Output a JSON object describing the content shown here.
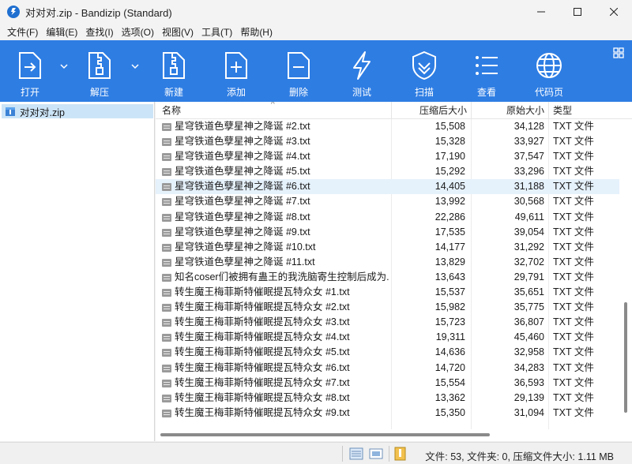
{
  "window": {
    "title": "对对对.zip - Bandizip (Standard)"
  },
  "menu": [
    "文件(F)",
    "编辑(E)",
    "查找(I)",
    "选项(O)",
    "视图(V)",
    "工具(T)",
    "帮助(H)"
  ],
  "toolbar": {
    "open": "打开",
    "extract": "解压",
    "new": "新建",
    "add": "添加",
    "delete": "删除",
    "test": "测试",
    "scan": "扫描",
    "view": "查看",
    "codepage": "代码页"
  },
  "sidebar": {
    "archive_name": "对对对.zip"
  },
  "columns": {
    "name": "名称",
    "compressed": "压缩后大小",
    "original": "原始大小",
    "type": "类型"
  },
  "files": [
    {
      "name": "星穹铁道色孽星神之降诞 #2.txt",
      "compressed": "15,508",
      "original": "34,128",
      "type": "TXT 文件"
    },
    {
      "name": "星穹铁道色孽星神之降诞 #3.txt",
      "compressed": "15,328",
      "original": "33,927",
      "type": "TXT 文件"
    },
    {
      "name": "星穹铁道色孽星神之降诞 #4.txt",
      "compressed": "17,190",
      "original": "37,547",
      "type": "TXT 文件"
    },
    {
      "name": "星穹铁道色孽星神之降诞 #5.txt",
      "compressed": "15,292",
      "original": "33,296",
      "type": "TXT 文件"
    },
    {
      "name": "星穹铁道色孽星神之降诞 #6.txt",
      "compressed": "14,405",
      "original": "31,188",
      "type": "TXT 文件",
      "selected": true
    },
    {
      "name": "星穹铁道色孽星神之降诞 #7.txt",
      "compressed": "13,992",
      "original": "30,568",
      "type": "TXT 文件"
    },
    {
      "name": "星穹铁道色孽星神之降诞 #8.txt",
      "compressed": "22,286",
      "original": "49,611",
      "type": "TXT 文件"
    },
    {
      "name": "星穹铁道色孽星神之降诞 #9.txt",
      "compressed": "17,535",
      "original": "39,054",
      "type": "TXT 文件"
    },
    {
      "name": "星穹铁道色孽星神之降诞 #10.txt",
      "compressed": "14,177",
      "original": "31,292",
      "type": "TXT 文件"
    },
    {
      "name": "星穹铁道色孽星神之降诞 #11.txt",
      "compressed": "13,829",
      "original": "32,702",
      "type": "TXT 文件"
    },
    {
      "name": "知名coser们被拥有蛊王的我洗脑寄生控制后成为...",
      "compressed": "13,643",
      "original": "29,791",
      "type": "TXT 文件"
    },
    {
      "name": "转生魔王梅菲斯特催眠提瓦特众女 #1.txt",
      "compressed": "15,537",
      "original": "35,651",
      "type": "TXT 文件"
    },
    {
      "name": "转生魔王梅菲斯特催眠提瓦特众女 #2.txt",
      "compressed": "15,982",
      "original": "35,775",
      "type": "TXT 文件"
    },
    {
      "name": "转生魔王梅菲斯特催眠提瓦特众女 #3.txt",
      "compressed": "15,723",
      "original": "36,807",
      "type": "TXT 文件"
    },
    {
      "name": "转生魔王梅菲斯特催眠提瓦特众女 #4.txt",
      "compressed": "19,311",
      "original": "45,460",
      "type": "TXT 文件"
    },
    {
      "name": "转生魔王梅菲斯特催眠提瓦特众女 #5.txt",
      "compressed": "14,636",
      "original": "32,958",
      "type": "TXT 文件"
    },
    {
      "name": "转生魔王梅菲斯特催眠提瓦特众女 #6.txt",
      "compressed": "14,720",
      "original": "34,283",
      "type": "TXT 文件"
    },
    {
      "name": "转生魔王梅菲斯特催眠提瓦特众女 #7.txt",
      "compressed": "15,554",
      "original": "36,593",
      "type": "TXT 文件"
    },
    {
      "name": "转生魔王梅菲斯特催眠提瓦特众女 #8.txt",
      "compressed": "13,362",
      "original": "29,139",
      "type": "TXT 文件"
    },
    {
      "name": "转生魔王梅菲斯特催眠提瓦特众女 #9.txt",
      "compressed": "15,350",
      "original": "31,094",
      "type": "TXT 文件"
    }
  ],
  "status": {
    "text": "文件: 53, 文件夹: 0, 压缩文件大小: 1.11 MB"
  },
  "colors": {
    "toolbar_bg": "#2e7de3",
    "selected_row": "#e5f1fb",
    "sidebar_selected": "#cce4f7"
  }
}
